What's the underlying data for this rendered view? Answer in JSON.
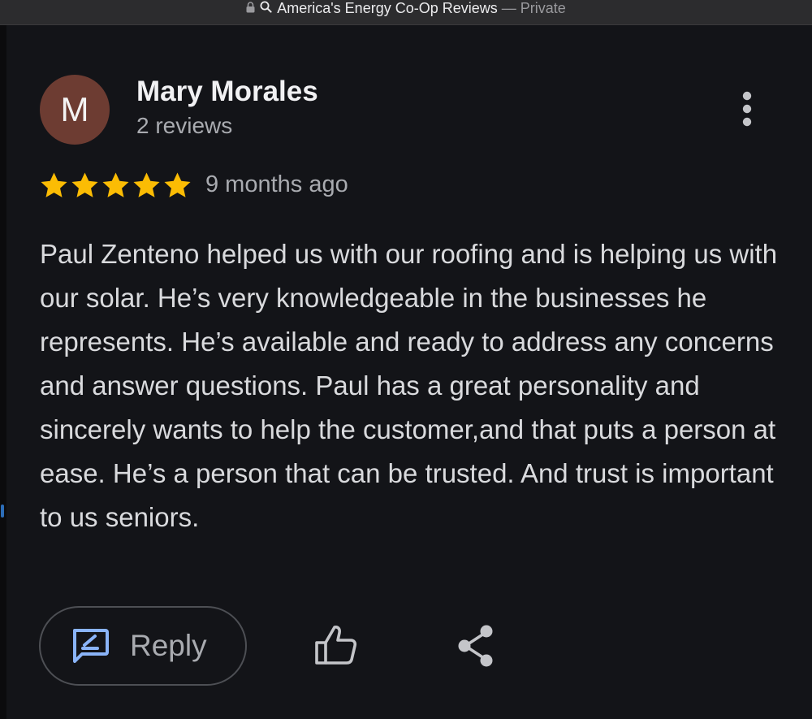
{
  "window": {
    "title": "America's Energy Co-Op Reviews",
    "separator": "—",
    "mode": "Private",
    "icons": [
      "lock-icon",
      "search-icon"
    ]
  },
  "review": {
    "author": {
      "initial": "M",
      "name": "Mary Morales",
      "review_count": "2 reviews",
      "avatar_color": "#6d3c32"
    },
    "rating": 5,
    "max_rating": 5,
    "star_color": "#fbbc04",
    "time": "9 months ago",
    "text": "Paul Zenteno helped us with our roofing and is helping us with our solar. He’s very knowledgeable in the businesses he represents. He’s available and ready to address any concerns and answer questions. Paul has a great personality and sincerely wants to help the customer,and that puts a person at ease. He’s a person that can be trusted. And trust is important to us seniors."
  },
  "actions": {
    "reply_label": "Reply",
    "reply_icon": "reply-icon",
    "like_icon": "thumbs-up-icon",
    "share_icon": "share-icon",
    "more_icon": "more-vert-icon",
    "accent_color": "#8ab4f8"
  }
}
